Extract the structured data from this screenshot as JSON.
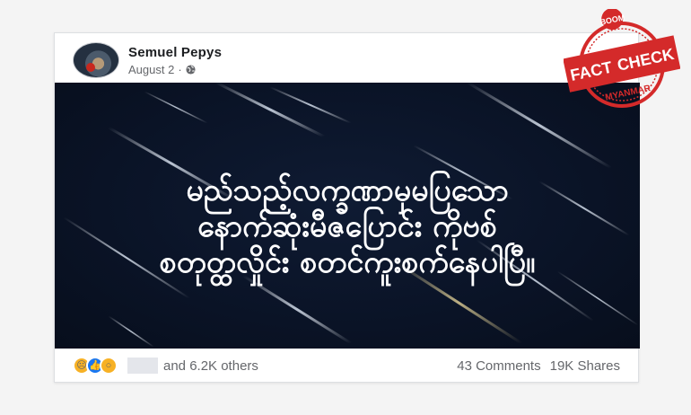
{
  "post": {
    "author": "Semuel Pepys",
    "date": "August 2",
    "date_separator": "·",
    "image_text": [
      "မည်သည့်လက္ခဏာမှမပြသော",
      "နောက်ဆုံးမီဇပြောင်း ကိုဗစ်",
      "စတုတ္ထလှိုင်း စတင်ကူးစက်နေပါပြီ။"
    ]
  },
  "footer": {
    "reaction_icons": [
      "sad-face-icon",
      "like-thumb-icon",
      "wow-face-icon"
    ],
    "others_text": "and 6.2K others",
    "comments": "43 Comments",
    "shares": "19K Shares"
  },
  "stamp": {
    "top_text": "BOOM",
    "main_text_1": "FACT",
    "main_text_2": "CHECK",
    "bottom_text": "MYANMAR"
  },
  "colors": {
    "stamp_red": "#d42a2a",
    "image_bg": "#0a1326",
    "like_blue": "#1877f2",
    "reaction_yellow": "#f7b125"
  }
}
